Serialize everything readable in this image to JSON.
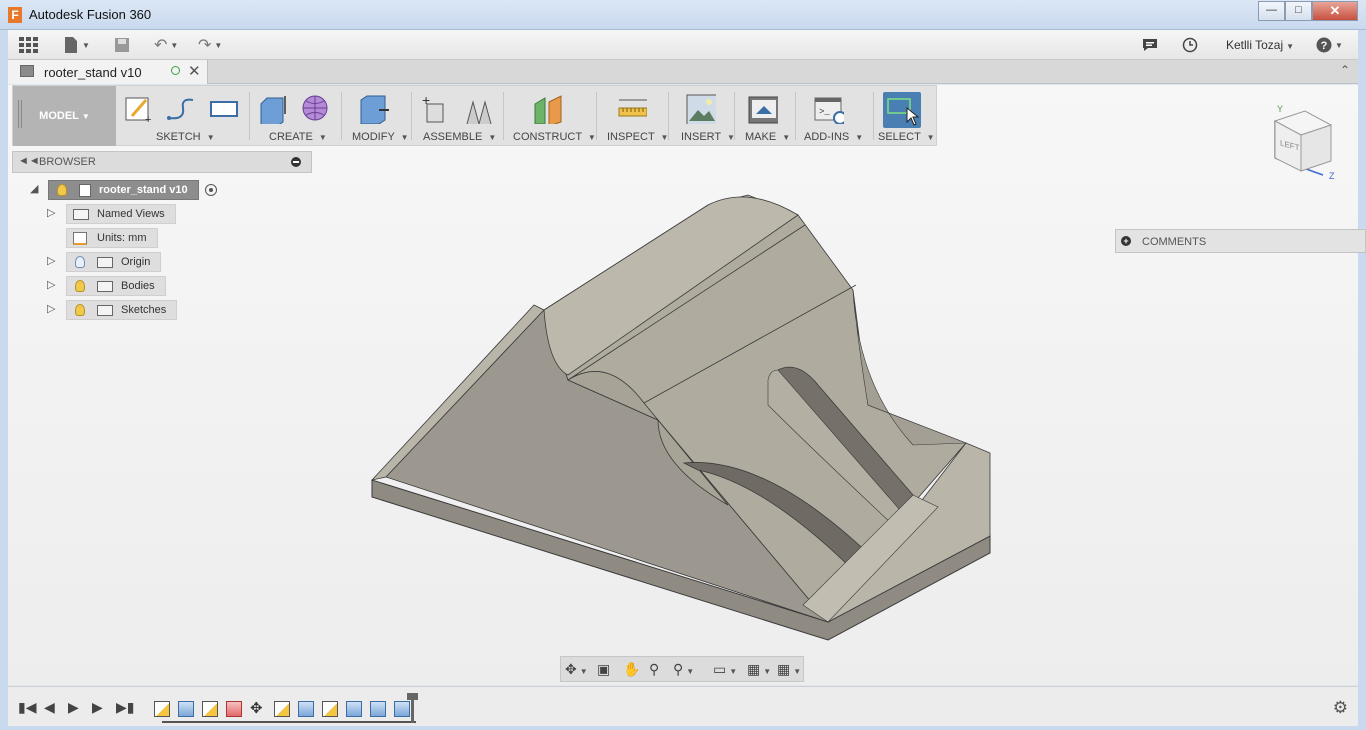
{
  "window": {
    "title": "Autodesk Fusion 360"
  },
  "qat": {
    "user_name": "Ketlli Tozaj"
  },
  "tab": {
    "name": "rooter_stand v10"
  },
  "ribbon": {
    "workspace": "MODEL",
    "groups": [
      "SKETCH",
      "CREATE",
      "MODIFY",
      "ASSEMBLE",
      "CONSTRUCT",
      "INSPECT",
      "INSERT",
      "MAKE",
      "ADD-INS",
      "SELECT"
    ]
  },
  "browser": {
    "title": "BROWSER",
    "root": "rooter_stand v10",
    "items": [
      "Named Views",
      "Units: mm",
      "Origin",
      "Bodies",
      "Sketches"
    ]
  },
  "comments": {
    "label": "COMMENTS"
  },
  "viewcube": {
    "face": "LEFT",
    "axis_y": "Y",
    "axis_z": "Z"
  },
  "colors": {
    "select_active": "#4a7fb3",
    "model_body": "#b7b2a6"
  }
}
